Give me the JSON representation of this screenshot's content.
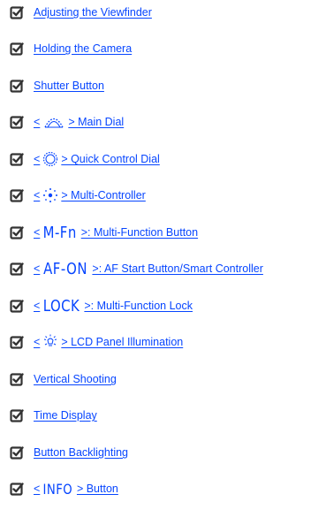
{
  "icons": {
    "checkbox": "checked-box-icon",
    "main_dial": "main-dial-icon",
    "quick_control_dial": "quick-control-dial-icon",
    "multi_controller": "multi-controller-icon",
    "lcd_illumination": "lcd-illumination-icon"
  },
  "colors": {
    "link": "#0645ff",
    "checkbox": "#333333"
  },
  "items": [
    {
      "label": "Adjusting the Viewfinder"
    },
    {
      "label": "Holding the Camera"
    },
    {
      "label": "Shutter Button"
    },
    {
      "prefix": "<",
      "suffix": "> Main Dial"
    },
    {
      "prefix": "<",
      "suffix": "> Quick Control Dial"
    },
    {
      "prefix": "<",
      "suffix": "> Multi-Controller"
    },
    {
      "prefix": "<",
      "button": "M-Fn",
      "suffix": ">: Multi-Function Button"
    },
    {
      "prefix": "<",
      "button": "AF-ON",
      "suffix": ">: AF Start Button/Smart Controller"
    },
    {
      "prefix": "<",
      "button": "LOCK",
      "suffix": ">: Multi-Function Lock"
    },
    {
      "prefix": "<",
      "suffix": "> LCD Panel Illumination"
    },
    {
      "label": "Vertical Shooting"
    },
    {
      "label": "Time Display"
    },
    {
      "label": "Button Backlighting"
    },
    {
      "prefix": "<",
      "button": "INFO",
      "suffix": "> Button"
    }
  ]
}
